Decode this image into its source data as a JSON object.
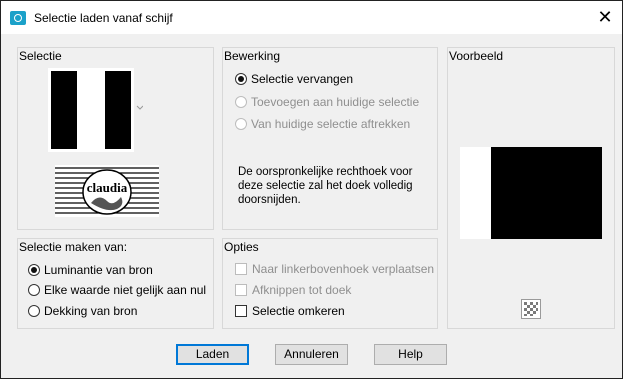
{
  "window": {
    "title": "Selectie laden vanaf schijf",
    "icon": "camera-app-icon",
    "close_symbol": "✕"
  },
  "selectie": {
    "label": "Selectie",
    "logo_text": "claudia"
  },
  "bewerking": {
    "label": "Bewerking",
    "options": [
      {
        "label": "Selectie vervangen",
        "checked": true,
        "enabled": true
      },
      {
        "label": "Toevoegen aan huidige selectie",
        "checked": false,
        "enabled": false
      },
      {
        "label": "Van huidige selectie aftrekken",
        "checked": false,
        "enabled": false
      }
    ],
    "description": "De oorspronkelijke rechthoek voor deze selectie zal het doek volledig doorsnijden."
  },
  "voorbeeld": {
    "label": "Voorbeeld"
  },
  "maken_van": {
    "label": "Selectie maken van:",
    "options": [
      {
        "label": "Luminantie van bron",
        "checked": true
      },
      {
        "label": "Elke waarde niet gelijk aan nul",
        "checked": false
      },
      {
        "label": "Dekking van bron",
        "checked": false
      }
    ]
  },
  "opties": {
    "label": "Opties",
    "checkboxes": [
      {
        "label": "Naar linkerbovenhoek verplaatsen",
        "checked": false,
        "enabled": false
      },
      {
        "label": "Afknippen tot doek",
        "checked": false,
        "enabled": false
      },
      {
        "label": "Selectie omkeren",
        "checked": false,
        "enabled": true
      }
    ]
  },
  "buttons": {
    "load": "Laden",
    "cancel": "Annuleren",
    "help": "Help"
  }
}
